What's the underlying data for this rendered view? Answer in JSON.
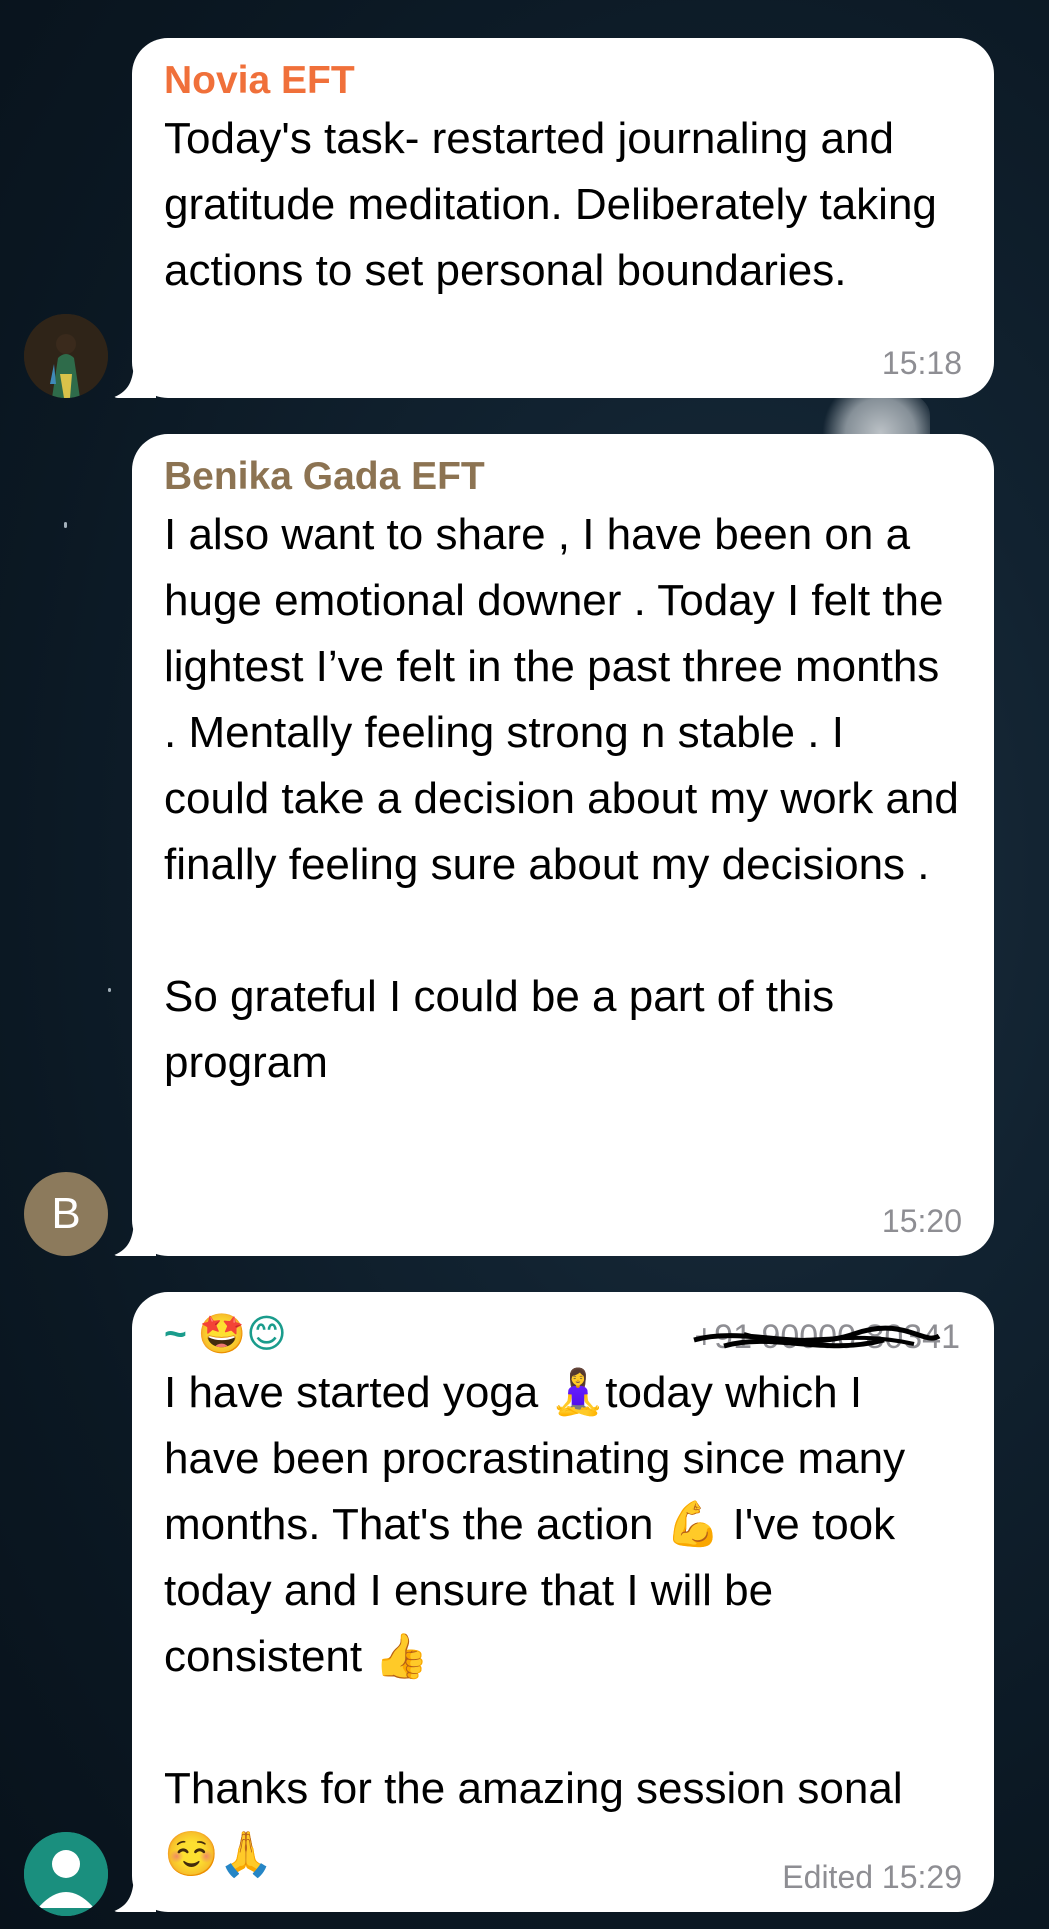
{
  "messages": [
    {
      "sender": "Novia EFT",
      "sender_color": "#f0703a",
      "text": "Today's task- restarted journaling and gratitude meditation. Deliberately taking actions to set personal boundaries.",
      "time": "15:18",
      "avatar": "profile-photo"
    },
    {
      "sender": "Benika Gada EFT",
      "sender_color": "#8c7352",
      "text": "I also want to share , I have been on a huge emotional downer . Today I felt the lightest I’ve felt in the past three months . Mentally feeling strong n stable . I could take a decision about my work and finally feeling sure about my decisions .\n\nSo grateful I could be a part of this program",
      "time": "15:20",
      "avatar_letter": "B",
      "avatar_color": "#8c7a5c"
    },
    {
      "sender": "~ 🤩😊",
      "sender_color": "#1a9c8c",
      "phone": "+91 90000 80341",
      "text": "I have started yoga 🧘‍♀️today which I have been procrastinating since many months. That's the action 💪 I've took today and I ensure that I will be consistent 👍\n\nThanks for the amazing session sonal ☺️🙏",
      "time": "Edited 15:29",
      "avatar": "default-user",
      "avatar_color": "#1a8f7e"
    }
  ]
}
